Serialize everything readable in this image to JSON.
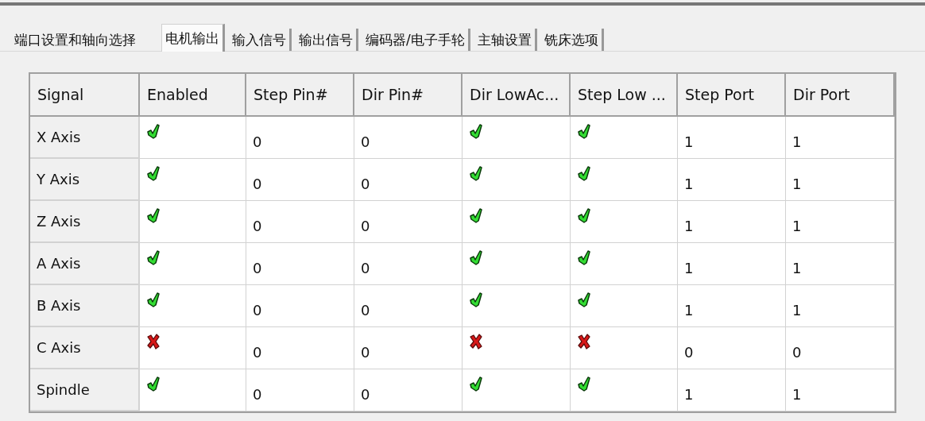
{
  "tabs": [
    {
      "label": "端口设置和轴向选择",
      "selected": false
    },
    {
      "label": "电机输出",
      "selected": true
    },
    {
      "label": "输入信号",
      "selected": false
    },
    {
      "label": "输出信号",
      "selected": false
    },
    {
      "label": "编码器/电子手轮",
      "selected": false
    },
    {
      "label": "主轴设置",
      "selected": false
    },
    {
      "label": "铣床选项",
      "selected": false
    }
  ],
  "table": {
    "columns": [
      "Signal",
      "Enabled",
      "Step Pin#",
      "Dir Pin#",
      "Dir LowAc...",
      "Step Low ...",
      "Step Port",
      "Dir Port"
    ],
    "rows": [
      {
        "signal": "X Axis",
        "enabled": true,
        "step_pin": "0",
        "dir_pin": "0",
        "dir_low_active": true,
        "step_low_active": true,
        "step_port": "1",
        "dir_port": "1"
      },
      {
        "signal": "Y Axis",
        "enabled": true,
        "step_pin": "0",
        "dir_pin": "0",
        "dir_low_active": true,
        "step_low_active": true,
        "step_port": "1",
        "dir_port": "1"
      },
      {
        "signal": "Z Axis",
        "enabled": true,
        "step_pin": "0",
        "dir_pin": "0",
        "dir_low_active": true,
        "step_low_active": true,
        "step_port": "1",
        "dir_port": "1"
      },
      {
        "signal": "A Axis",
        "enabled": true,
        "step_pin": "0",
        "dir_pin": "0",
        "dir_low_active": true,
        "step_low_active": true,
        "step_port": "1",
        "dir_port": "1"
      },
      {
        "signal": "B Axis",
        "enabled": true,
        "step_pin": "0",
        "dir_pin": "0",
        "dir_low_active": true,
        "step_low_active": true,
        "step_port": "1",
        "dir_port": "1"
      },
      {
        "signal": "C Axis",
        "enabled": false,
        "step_pin": "0",
        "dir_pin": "0",
        "dir_low_active": false,
        "step_low_active": false,
        "step_port": "0",
        "dir_port": "0"
      },
      {
        "signal": "Spindle",
        "enabled": true,
        "step_pin": "0",
        "dir_pin": "0",
        "dir_low_active": true,
        "step_low_active": true,
        "step_port": "1",
        "dir_port": "1"
      }
    ]
  }
}
